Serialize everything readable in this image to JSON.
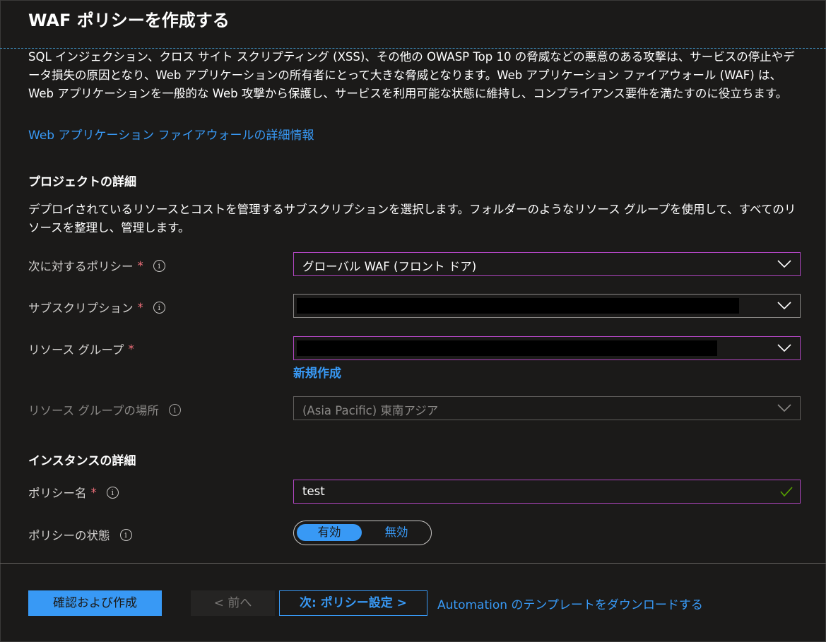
{
  "header": {
    "title": "WAF ポリシーを作成する"
  },
  "intro": {
    "description": "SQL インジェクション、クロス サイト スクリプティング (XSS)、その他の OWASP Top 10 の脅威などの悪意のある攻撃は、サービスの停止やデータ損失の原因となり、Web アプリケーションの所有者にとって大きな脅威となります。Web アプリケーション ファイアウォール (WAF) は、Web アプリケーションを一般的な Web 攻撃から保護し、サービスを利用可能な状態に維持し、コンプライアンス要件を満たすのに役立ちます。",
    "learn_more_link": "Web アプリケーション ファイアウォールの詳細情報"
  },
  "project": {
    "heading": "プロジェクトの詳細",
    "description": "デプロイされているリソースとコストを管理するサブスクリプションを選択します。フォルダーのようなリソース グループを使用して、すべてのリソースを整理し、管理します。",
    "policy_for": {
      "label": "次に対するポリシー",
      "required": "*",
      "value": "グローバル WAF (フロント ドア)"
    },
    "subscription": {
      "label": "サブスクリプション",
      "required": "*"
    },
    "resource_group": {
      "label": "リソース グループ",
      "required": "*",
      "create_new": "新規作成"
    },
    "resource_group_location": {
      "label": "リソース グループの場所",
      "value": "(Asia Pacific) 東南アジア"
    }
  },
  "instance": {
    "heading": "インスタンスの詳細",
    "policy_name": {
      "label": "ポリシー名",
      "required": "*",
      "value": "test"
    },
    "policy_state": {
      "label": "ポリシーの状態",
      "on": "有効",
      "off": "無効"
    }
  },
  "footer": {
    "review_create": "確認および作成",
    "previous": "< 前へ",
    "next": "次: ポリシー設定 >",
    "automation_link": "Automation のテンプレートをダウンロードする"
  },
  "icons": {
    "info": "info-icon",
    "dropdown": "chevron-down-icon",
    "valid": "checkmark-icon"
  },
  "colors": {
    "accent": "#3899f5",
    "focus_border": "#b146c2",
    "required": "#f1707b",
    "valid": "#57a300",
    "background": "#1b1a19"
  }
}
